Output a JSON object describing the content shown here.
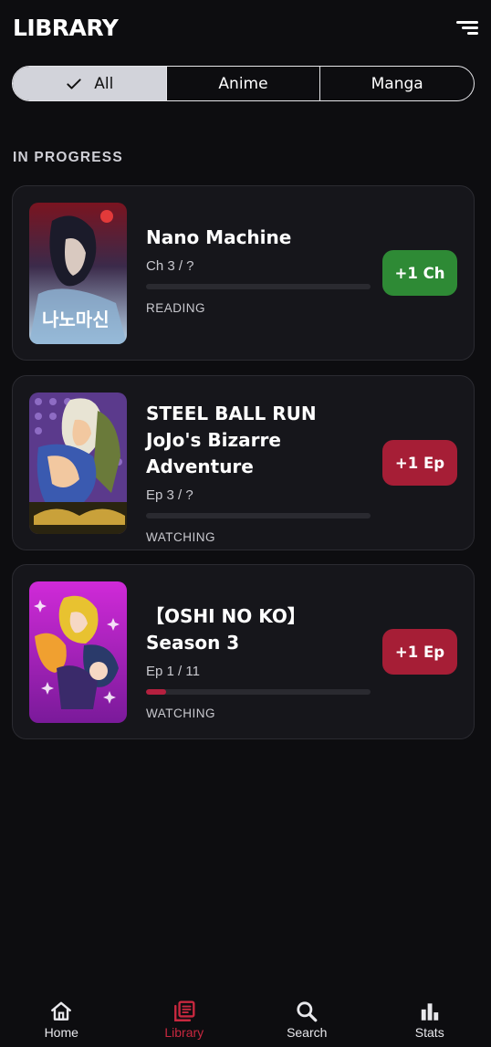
{
  "header": {
    "title": "LIBRARY"
  },
  "filters": [
    {
      "label": "All",
      "active": true
    },
    {
      "label": "Anime",
      "active": false
    },
    {
      "label": "Manga",
      "active": false
    }
  ],
  "section": {
    "title": "IN PROGRESS"
  },
  "items": [
    {
      "title": "Nano Machine",
      "progress_text": "Ch 3 / ?",
      "progress": 0,
      "status": "READING",
      "action_label": "+1 Ch",
      "action_color": "#2e8a35"
    },
    {
      "title": "STEEL BALL RUN JoJo's Bizarre Adventure",
      "progress_text": "Ep 3 / ?",
      "progress": 0,
      "status": "WATCHING",
      "action_label": "+1 Ep",
      "action_color": "#a61e36"
    },
    {
      "title": "【OSHI NO KO】Season 3",
      "progress_text": "Ep 1 / 11",
      "progress": 0.09,
      "status": "WATCHING",
      "action_label": "+1 Ep",
      "action_color": "#a61e36"
    }
  ],
  "nav": [
    {
      "label": "Home",
      "icon": "home-icon",
      "active": false
    },
    {
      "label": "Library",
      "icon": "library-icon",
      "active": true
    },
    {
      "label": "Search",
      "icon": "search-icon",
      "active": false
    },
    {
      "label": "Stats",
      "icon": "stats-icon",
      "active": false
    }
  ],
  "colors": {
    "accent": "#c8283f",
    "background": "#0d0d10",
    "card": "#16161b"
  }
}
